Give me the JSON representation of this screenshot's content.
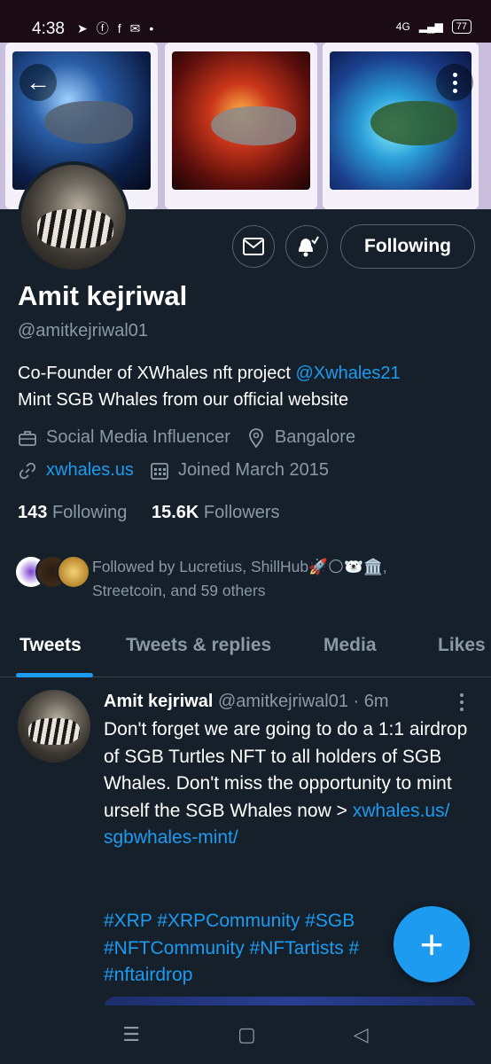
{
  "status_bar": {
    "time": "4:38",
    "network": "4G",
    "battery": "77"
  },
  "profile": {
    "name": "Amit kejriwal",
    "handle": "@amitkejriwal01",
    "bio_text": "Co-Founder of XWhales nft project",
    "bio_mention": "@Xwhales21",
    "bio_line2": "Mint SGB Whales from our official website",
    "category": "Social Media Influencer",
    "location": "Bangalore",
    "website": "xwhales.us",
    "joined": "Joined March 2015",
    "following_count": "143",
    "following_label": "Following",
    "followers_count": "15.6K",
    "followers_label": "Followers",
    "followed_by_line1": "Followed by Lucretius, ShillHub🚀🌕🐻‍❄️🏛️,",
    "followed_by_line2": "Streetcoin, and 59 others",
    "follow_button": "Following"
  },
  "tabs": [
    "Tweets",
    "Tweets & replies",
    "Media",
    "Likes"
  ],
  "tweet": {
    "author": "Amit kejriwal",
    "handle_time": "@amitkejriwal01 · 6m",
    "body": "Don't forget we are going to do a 1:1 airdrop of SGB Turtles NFT to all holders of SGB Whales. Don't miss the opportunity to mint urself the SGB Whales now > ",
    "link_1": "xwhales.us/",
    "link_2": "sgbwhales-mint/",
    "tags_line1": "#XRP #XRPCommunity #SGB",
    "tags_line2": "#NFTCommunity #NFTartists #",
    "tags_line3": "#nftairdrop"
  },
  "fab_label": "+",
  "colors": {
    "background": "#15202b",
    "accent": "#1d9bf0",
    "secondary_text": "#8b98a5",
    "border": "#536471"
  }
}
